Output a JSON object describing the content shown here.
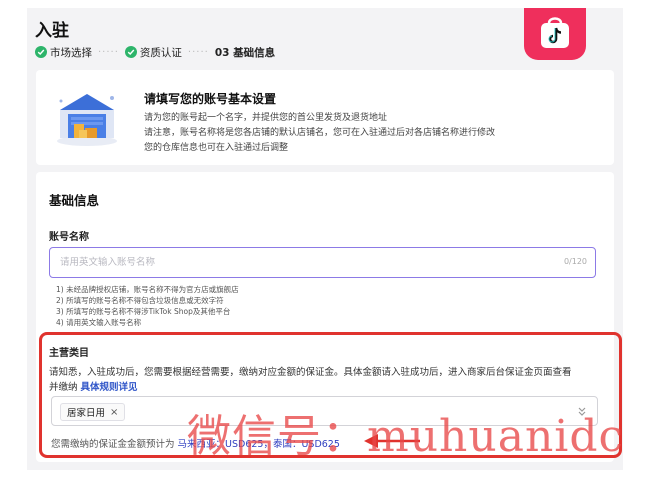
{
  "page": {
    "title": "入驻"
  },
  "steps": [
    {
      "label": "市场选择",
      "state": "done"
    },
    {
      "label": "资质认证",
      "state": "done"
    },
    {
      "label": "03 基础信息",
      "state": "current"
    }
  ],
  "brand": {
    "icon": "tiktok-shop-bag-icon",
    "color": "#ef2f5c"
  },
  "intro": {
    "heading": "请填写您的账号基本设置",
    "lines": [
      "请为您的账号起一个名字，并提供您的首公里发货及退货地址",
      "请注意，账号名称将是您各店铺的默认店铺名，您可在入驻通过后对各店铺名称进行修改",
      "您的仓库信息也可在入驻通过后调整"
    ]
  },
  "basic": {
    "title": "基础信息",
    "account_label": "账号名称",
    "account_placeholder": "请用英文输入账号名称",
    "account_value": "",
    "counter": "0/120",
    "rules": [
      "1) 未经品牌授权店铺，账号名称不得为官方店或旗舰店",
      "2) 所填写的账号名称不得包含垃圾信息或无效字符",
      "3) 所填写的账号名称不得涉TikTok Shop及其他平台",
      "4) 请用英文输入账号名称"
    ]
  },
  "category": {
    "label": "主营类目",
    "desc_line1": "请知悉，入驻成功后，您需要根据经营需要，缴纳对应金额的保证金。具体金额请入驻成功后，进入商家后台保证金页面查看",
    "desc_line2_prefix": "并缴纳 ",
    "desc_link": "具体规则详见",
    "selected_tag": "居家日用",
    "tag_remove": "×",
    "deposit_prefix": "您需缴纳的保证金金额预计为 ",
    "deposit_value": "马来西亚：USD625，泰国：USD625"
  },
  "annotation": {
    "highlight_color": "#e0332e",
    "watermark": "微信号：muhuanidc"
  }
}
